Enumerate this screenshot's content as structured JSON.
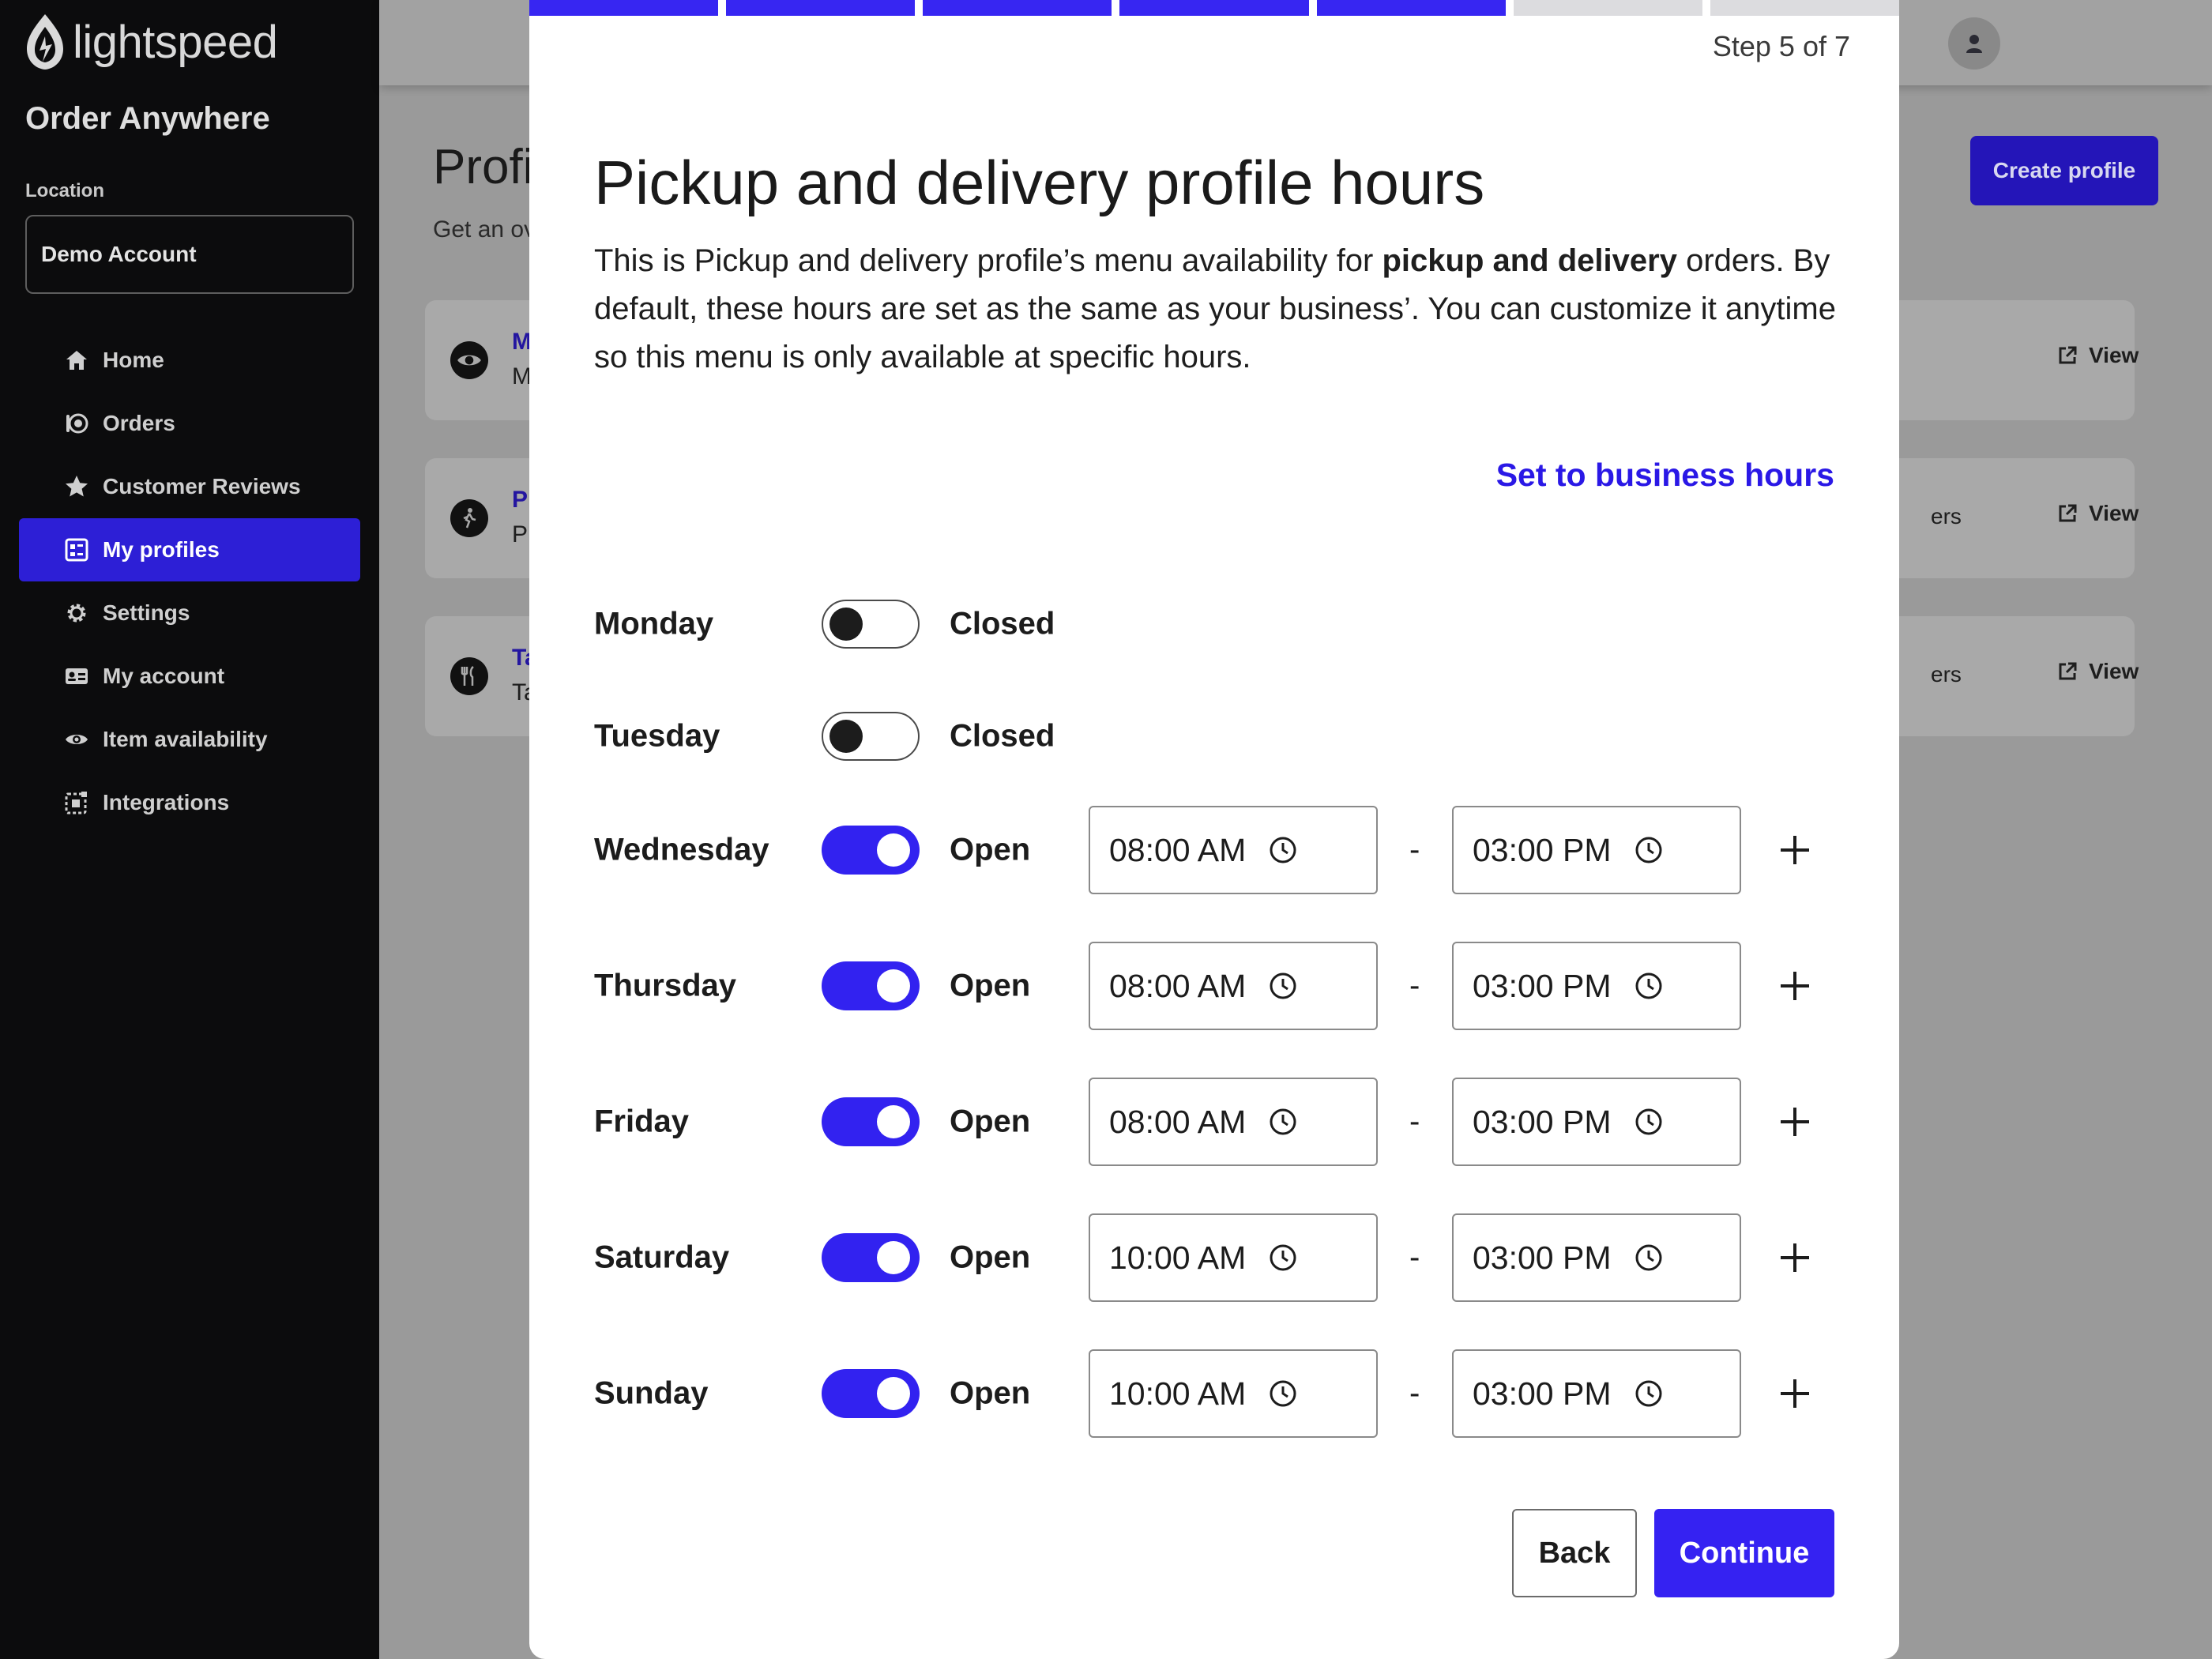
{
  "sidebar": {
    "brand": "lightspeed",
    "app_name": "Order Anywhere",
    "location_label": "Location",
    "location_value": "Demo Account",
    "nav": [
      {
        "label": "Home",
        "icon": "home-icon",
        "active": false
      },
      {
        "label": "Orders",
        "icon": "orders-icon",
        "active": false
      },
      {
        "label": "Customer Reviews",
        "icon": "star-icon",
        "active": false
      },
      {
        "label": "My profiles",
        "icon": "profiles-icon",
        "active": true
      },
      {
        "label": "Settings",
        "icon": "gear-icon",
        "active": false
      },
      {
        "label": "My account",
        "icon": "id-card-icon",
        "active": false
      },
      {
        "label": "Item availability",
        "icon": "eye-icon",
        "active": false
      },
      {
        "label": "Integrations",
        "icon": "integrations-icon",
        "active": false
      }
    ]
  },
  "background": {
    "page_title": "Profi",
    "page_subtitle": "Get an ov",
    "create_button": "Create profile",
    "cards": [
      {
        "name": "M",
        "desc": "M",
        "right": "",
        "view": "View",
        "icon": "eye-icon"
      },
      {
        "name": "P",
        "desc": "P",
        "right": "ers",
        "view": "View",
        "icon": "walk-icon"
      },
      {
        "name": "Ta",
        "desc": "Ta",
        "right": "ers",
        "view": "View",
        "icon": "utensils-icon"
      }
    ]
  },
  "modal": {
    "step_text": "Step 5 of 7",
    "steps_total": 7,
    "steps_done": 5,
    "title": "Pickup and delivery profile hours",
    "desc_part1": "This is Pickup and delivery profile’s menu availability for ",
    "desc_bold": "pickup and delivery",
    "desc_part2": " orders. By default, these hours are set as the same as your business’. You can customize it anytime so this menu is only available at specific hours.",
    "set_link": "Set to business hours",
    "days": [
      {
        "day": "Monday",
        "open": false,
        "status": "Closed"
      },
      {
        "day": "Tuesday",
        "open": false,
        "status": "Closed"
      },
      {
        "day": "Wednesday",
        "open": true,
        "status": "Open",
        "start": "08:00 AM",
        "end": "03:00 PM"
      },
      {
        "day": "Thursday",
        "open": true,
        "status": "Open",
        "start": "08:00 AM",
        "end": "03:00 PM"
      },
      {
        "day": "Friday",
        "open": true,
        "status": "Open",
        "start": "08:00 AM",
        "end": "03:00 PM"
      },
      {
        "day": "Saturday",
        "open": true,
        "status": "Open",
        "start": "10:00 AM",
        "end": "03:00 PM"
      },
      {
        "day": "Sunday",
        "open": true,
        "status": "Open",
        "start": "10:00 AM",
        "end": "03:00 PM"
      }
    ],
    "separator": "-",
    "back_button": "Back",
    "continue_button": "Continue"
  },
  "colors": {
    "accent": "#3522f2",
    "sidebar_bg": "#0c0c0d",
    "active_nav": "#2d1fd6"
  }
}
